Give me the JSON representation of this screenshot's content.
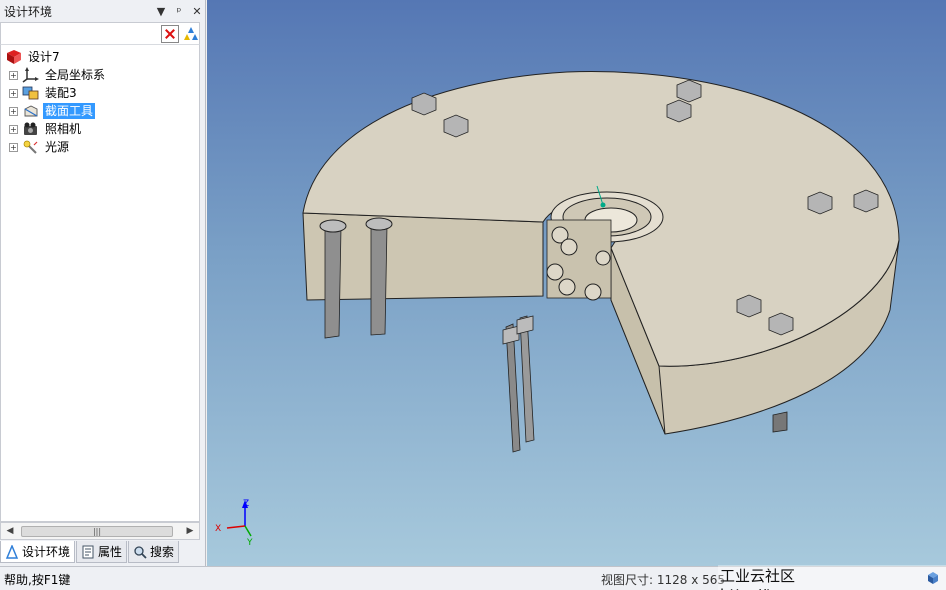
{
  "panel": {
    "title": "设计环境",
    "buttons": {
      "dropdown": "▼",
      "pin": "ᵖ",
      "close": "✕"
    }
  },
  "tree": {
    "root": {
      "label": "设计7",
      "icon": "design-root-icon"
    },
    "items": [
      {
        "label": "全局坐标系",
        "icon": "axes-icon",
        "expander": "+"
      },
      {
        "label": "装配3",
        "icon": "assembly-icon",
        "expander": "+"
      },
      {
        "label": "截面工具",
        "icon": "section-tool-icon",
        "expander": "+",
        "selected": true
      },
      {
        "label": "照相机",
        "icon": "camera-icon",
        "expander": "+"
      },
      {
        "label": "光源",
        "icon": "light-icon",
        "expander": "+"
      }
    ]
  },
  "scrollbar": {
    "left": "◀",
    "right": "▶",
    "thumb": "|||"
  },
  "tabs": [
    {
      "label": "设计环境",
      "icon": "design-env-icon",
      "active": true
    },
    {
      "label": "属性",
      "icon": "properties-icon"
    },
    {
      "label": "搜索",
      "icon": "search-icon"
    }
  ],
  "status": {
    "help": "帮助,按F1键",
    "view_size": "视图尺寸: 1128 x 565",
    "watermark": "工业云社区 http://top.caxa.com"
  },
  "axis_triad": {
    "x": "X",
    "y": "Y",
    "z": "Z"
  },
  "colors": {
    "viewport_top": "#5577b4",
    "viewport_bottom": "#a7c9dc",
    "part_face": "#d8d2c2",
    "selection": "#3399ff"
  }
}
